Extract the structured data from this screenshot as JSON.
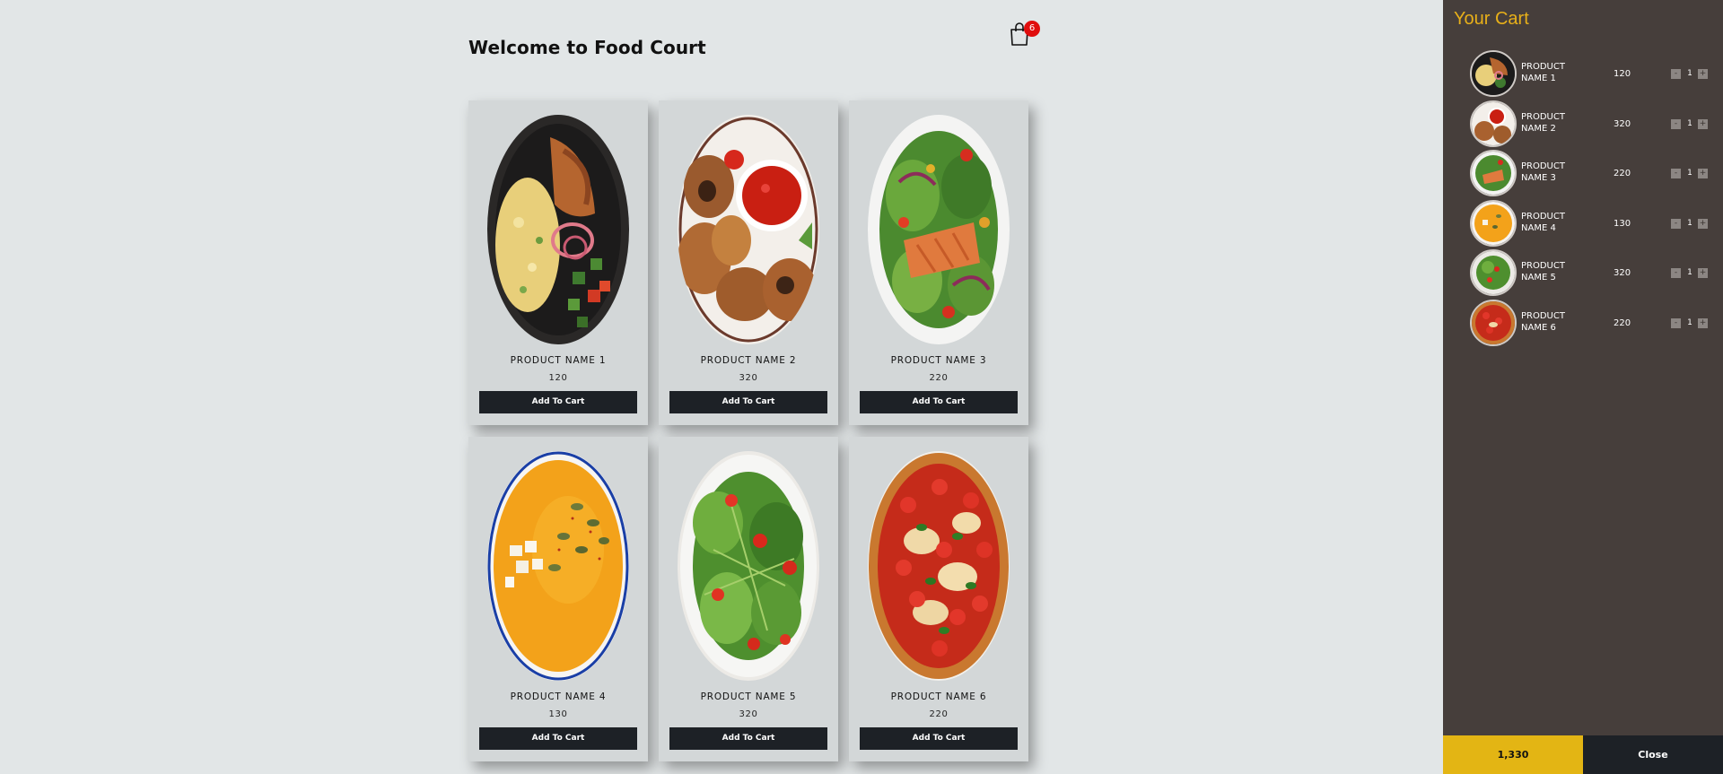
{
  "header": {
    "title": "Welcome to Food Court",
    "cart_count": "6"
  },
  "products": [
    {
      "name": "PRODUCT NAME 1",
      "price": "120",
      "button": "Add To Cart",
      "image": "grain-bowl-photo"
    },
    {
      "name": "PRODUCT NAME 2",
      "price": "320",
      "button": "Add To Cart",
      "image": "chicken-wings-photo"
    },
    {
      "name": "PRODUCT NAME 3",
      "price": "220",
      "button": "Add To Cart",
      "image": "salmon-salad-photo"
    },
    {
      "name": "PRODUCT NAME 4",
      "price": "130",
      "button": "Add To Cart",
      "image": "pumpkin-soup-photo"
    },
    {
      "name": "PRODUCT NAME 5",
      "price": "320",
      "button": "Add To Cart",
      "image": "green-salad-photo"
    },
    {
      "name": "PRODUCT NAME 6",
      "price": "220",
      "button": "Add To Cart",
      "image": "pizza-photo"
    }
  ],
  "cart": {
    "title": "Your Cart",
    "items": [
      {
        "name": "PRODUCT NAME 1",
        "price": "120",
        "qty": "1",
        "minus": "-",
        "plus": "+"
      },
      {
        "name": "PRODUCT NAME 2",
        "price": "320",
        "qty": "1",
        "minus": "-",
        "plus": "+"
      },
      {
        "name": "PRODUCT NAME 3",
        "price": "220",
        "qty": "1",
        "minus": "-",
        "plus": "+"
      },
      {
        "name": "PRODUCT NAME 4",
        "price": "130",
        "qty": "1",
        "minus": "-",
        "plus": "+"
      },
      {
        "name": "PRODUCT NAME 5",
        "price": "320",
        "qty": "1",
        "minus": "-",
        "plus": "+"
      },
      {
        "name": "PRODUCT NAME 6",
        "price": "220",
        "qty": "1",
        "minus": "-",
        "plus": "+"
      }
    ],
    "total": "1,330",
    "close_label": "Close"
  },
  "colors": {
    "background": "#e2e6e7",
    "card": "#d3d7d8",
    "button": "#1d2126",
    "panel": "#463e3b",
    "panel_title": "#e8b019",
    "total": "#e3b514",
    "badge": "#e00d0d"
  }
}
